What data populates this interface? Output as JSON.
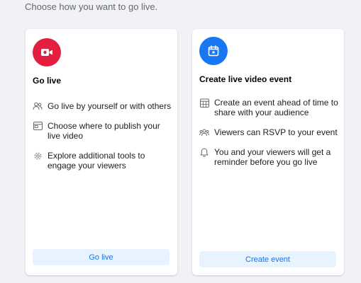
{
  "header": {
    "subtitle": "Choose how you want to go live."
  },
  "cards": [
    {
      "title": "Go live",
      "icon": "video-camera-icon",
      "accent": "#e41e3f",
      "features": [
        {
          "icon": "people-icon",
          "text": "Go live by yourself or with others"
        },
        {
          "icon": "browser-window-icon",
          "text": "Choose where to publish your live video"
        },
        {
          "icon": "gear-icon",
          "text": "Explore additional tools to engage your viewers"
        }
      ],
      "button_label": "Go live"
    },
    {
      "title": "Create live video event",
      "icon": "calendar-star-icon",
      "accent": "#1877f2",
      "features": [
        {
          "icon": "calendar-grid-icon",
          "text": "Create an event ahead of time to share with your audience"
        },
        {
          "icon": "group-icon",
          "text": "Viewers can RSVP to your event"
        },
        {
          "icon": "bell-icon",
          "text": "You and your viewers will get a reminder before you go live"
        }
      ],
      "button_label": "Create event"
    }
  ],
  "colors": {
    "background": "#f0f2f5",
    "button_bg": "#e7f3ff",
    "button_text": "#1b74e4"
  }
}
